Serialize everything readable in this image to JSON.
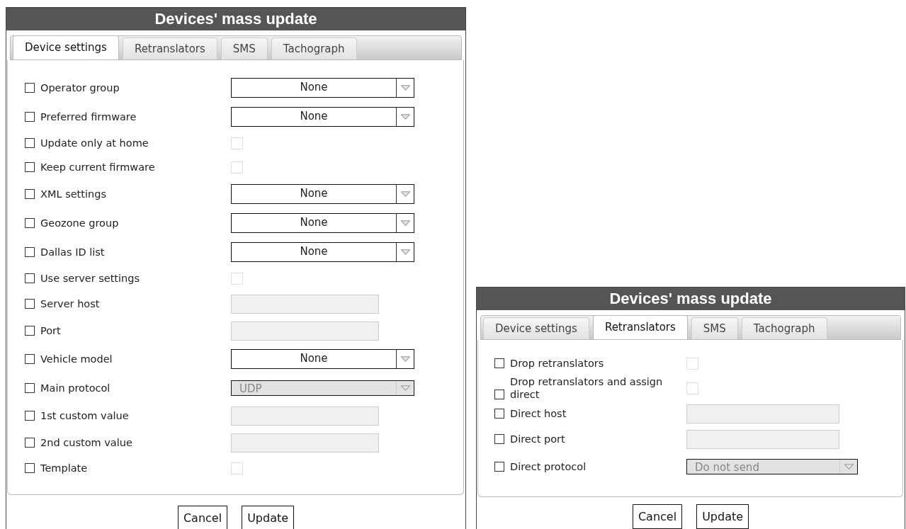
{
  "dialogs": [
    {
      "title": "Devices' mass update",
      "tabs": [
        {
          "label": "Device settings",
          "selected": true
        },
        {
          "label": "Retranslators",
          "selected": false
        },
        {
          "label": "SMS",
          "selected": false
        },
        {
          "label": "Tachograph",
          "selected": false
        }
      ],
      "rows": [
        {
          "label": "Operator group",
          "checked": false,
          "kind": "select",
          "value": "None",
          "disabled": false
        },
        {
          "label": "Preferred firmware",
          "checked": false,
          "kind": "select",
          "value": "None",
          "disabled": false
        },
        {
          "label": "Update only at home",
          "checked": false,
          "kind": "checkbox",
          "on": false,
          "disabled": true
        },
        {
          "label": "Keep current firmware",
          "checked": false,
          "kind": "checkbox",
          "on": false,
          "disabled": true
        },
        {
          "label": "XML settings",
          "checked": false,
          "kind": "select",
          "value": "None",
          "disabled": false
        },
        {
          "label": "Geozone group",
          "checked": false,
          "kind": "select",
          "value": "None",
          "disabled": false
        },
        {
          "label": "Dallas ID list",
          "checked": false,
          "kind": "select",
          "value": "None",
          "disabled": false
        },
        {
          "label": "Use server settings",
          "checked": false,
          "kind": "checkbox",
          "on": false,
          "disabled": true
        },
        {
          "label": "Server host",
          "checked": false,
          "kind": "text",
          "disabled": true
        },
        {
          "label": "Port",
          "checked": false,
          "kind": "text",
          "disabled": true
        },
        {
          "label": "Vehicle model",
          "checked": false,
          "kind": "select",
          "value": "None",
          "disabled": false
        },
        {
          "label": "Main protocol",
          "checked": false,
          "kind": "select",
          "value": "UDP",
          "disabled": true
        },
        {
          "label": "1st custom value",
          "checked": false,
          "kind": "text",
          "disabled": true
        },
        {
          "label": "2nd custom value",
          "checked": false,
          "kind": "text",
          "disabled": true
        },
        {
          "label": "Template",
          "checked": false,
          "kind": "checkbox",
          "on": false,
          "disabled": true
        }
      ],
      "buttons": [
        "Cancel",
        "Update"
      ]
    },
    {
      "title": "Devices' mass update",
      "tabs": [
        {
          "label": "Device settings",
          "selected": false
        },
        {
          "label": "Retranslators",
          "selected": true
        },
        {
          "label": "SMS",
          "selected": false
        },
        {
          "label": "Tachograph",
          "selected": false
        }
      ],
      "rows": [
        {
          "label": "Drop retranslators",
          "checked": false,
          "kind": "checkbox",
          "on": false,
          "disabled": true
        },
        {
          "label": "Drop retranslators and assign direct",
          "checked": false,
          "kind": "checkbox",
          "on": false,
          "disabled": true
        },
        {
          "label": "Direct host",
          "checked": false,
          "kind": "text",
          "disabled": true
        },
        {
          "label": "Direct port",
          "checked": false,
          "kind": "text",
          "disabled": true
        },
        {
          "label": "Direct protocol",
          "checked": false,
          "kind": "select",
          "value": "Do not send",
          "disabled": true
        }
      ],
      "buttons": [
        "Cancel",
        "Update"
      ]
    }
  ]
}
